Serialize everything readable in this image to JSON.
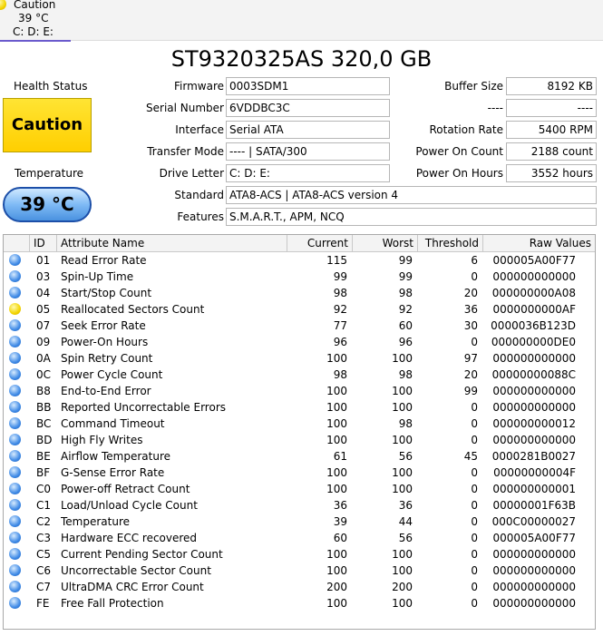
{
  "tab": {
    "status": "Caution",
    "temperature": "39 °C",
    "drives": "C: D: E:"
  },
  "model": "ST9320325AS 320,0 GB",
  "health": {
    "label": "Health Status",
    "value": "Caution"
  },
  "temperature": {
    "label": "Temperature",
    "value": "39 °C"
  },
  "fields": {
    "firmware_label": "Firmware",
    "firmware": "0003SDM1",
    "serial_label": "Serial Number",
    "serial": "6VDDBC3C",
    "interface_label": "Interface",
    "interface": "Serial ATA",
    "transfer_label": "Transfer Mode",
    "transfer": "---- | SATA/300",
    "drive_letter_label": "Drive Letter",
    "drive_letter": "C: D: E:",
    "standard_label": "Standard",
    "standard": "ATA8-ACS | ATA8-ACS version 4",
    "features_label": "Features",
    "features": "S.M.A.R.T., APM, NCQ",
    "buffer_label": "Buffer Size",
    "buffer": "8192 KB",
    "blank_label": "----",
    "blank": "----",
    "rotation_label": "Rotation Rate",
    "rotation": "5400 RPM",
    "power_count_label": "Power On Count",
    "power_count": "2188 count",
    "power_hours_label": "Power On Hours",
    "power_hours": "3552 hours"
  },
  "table": {
    "columns": [
      "ID",
      "Attribute Name",
      "Current",
      "Worst",
      "Threshold",
      "Raw Values"
    ],
    "rows": [
      {
        "status": "good",
        "id": "01",
        "name": "Read Error Rate",
        "current": "115",
        "worst": "99",
        "threshold": "6",
        "raw": "000005A00F77"
      },
      {
        "status": "good",
        "id": "03",
        "name": "Spin-Up Time",
        "current": "99",
        "worst": "99",
        "threshold": "0",
        "raw": "000000000000"
      },
      {
        "status": "good",
        "id": "04",
        "name": "Start/Stop Count",
        "current": "98",
        "worst": "98",
        "threshold": "20",
        "raw": "000000000A08"
      },
      {
        "status": "caution",
        "id": "05",
        "name": "Reallocated Sectors Count",
        "current": "92",
        "worst": "92",
        "threshold": "36",
        "raw": "0000000000AF"
      },
      {
        "status": "good",
        "id": "07",
        "name": "Seek Error Rate",
        "current": "77",
        "worst": "60",
        "threshold": "30",
        "raw": "0000036B123D"
      },
      {
        "status": "good",
        "id": "09",
        "name": "Power-On Hours",
        "current": "96",
        "worst": "96",
        "threshold": "0",
        "raw": "000000000DE0"
      },
      {
        "status": "good",
        "id": "0A",
        "name": "Spin Retry Count",
        "current": "100",
        "worst": "100",
        "threshold": "97",
        "raw": "000000000000"
      },
      {
        "status": "good",
        "id": "0C",
        "name": "Power Cycle Count",
        "current": "98",
        "worst": "98",
        "threshold": "20",
        "raw": "00000000088C"
      },
      {
        "status": "good",
        "id": "B8",
        "name": "End-to-End Error",
        "current": "100",
        "worst": "100",
        "threshold": "99",
        "raw": "000000000000"
      },
      {
        "status": "good",
        "id": "BB",
        "name": "Reported Uncorrectable Errors",
        "current": "100",
        "worst": "100",
        "threshold": "0",
        "raw": "000000000000"
      },
      {
        "status": "good",
        "id": "BC",
        "name": "Command Timeout",
        "current": "100",
        "worst": "98",
        "threshold": "0",
        "raw": "000000000012"
      },
      {
        "status": "good",
        "id": "BD",
        "name": "High Fly Writes",
        "current": "100",
        "worst": "100",
        "threshold": "0",
        "raw": "000000000000"
      },
      {
        "status": "good",
        "id": "BE",
        "name": "Airflow Temperature",
        "current": "61",
        "worst": "56",
        "threshold": "45",
        "raw": "0000281B0027"
      },
      {
        "status": "good",
        "id": "BF",
        "name": "G-Sense Error Rate",
        "current": "100",
        "worst": "100",
        "threshold": "0",
        "raw": "00000000004F"
      },
      {
        "status": "good",
        "id": "C0",
        "name": "Power-off Retract Count",
        "current": "100",
        "worst": "100",
        "threshold": "0",
        "raw": "000000000001"
      },
      {
        "status": "good",
        "id": "C1",
        "name": "Load/Unload Cycle Count",
        "current": "36",
        "worst": "36",
        "threshold": "0",
        "raw": "00000001F63B"
      },
      {
        "status": "good",
        "id": "C2",
        "name": "Temperature",
        "current": "39",
        "worst": "44",
        "threshold": "0",
        "raw": "000C00000027"
      },
      {
        "status": "good",
        "id": "C3",
        "name": "Hardware ECC recovered",
        "current": "60",
        "worst": "56",
        "threshold": "0",
        "raw": "000005A00F77"
      },
      {
        "status": "good",
        "id": "C5",
        "name": "Current Pending Sector Count",
        "current": "100",
        "worst": "100",
        "threshold": "0",
        "raw": "000000000000"
      },
      {
        "status": "good",
        "id": "C6",
        "name": "Uncorrectable Sector Count",
        "current": "100",
        "worst": "100",
        "threshold": "0",
        "raw": "000000000000"
      },
      {
        "status": "good",
        "id": "C7",
        "name": "UltraDMA CRC Error Count",
        "current": "200",
        "worst": "200",
        "threshold": "0",
        "raw": "000000000000"
      },
      {
        "status": "good",
        "id": "FE",
        "name": "Free Fall Protection",
        "current": "100",
        "worst": "100",
        "threshold": "0",
        "raw": "000000000000"
      }
    ]
  }
}
